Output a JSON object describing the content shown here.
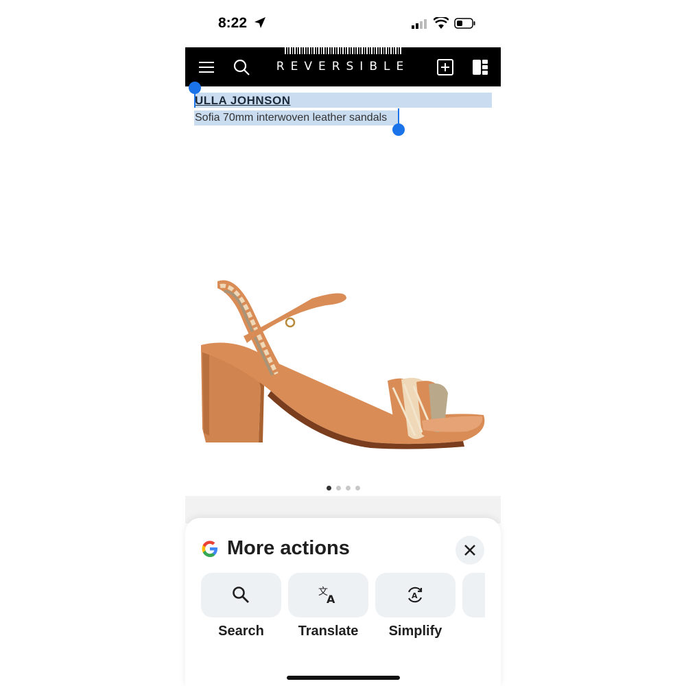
{
  "status_bar": {
    "time": "8:22"
  },
  "header": {
    "brand": "REVERSIBLE"
  },
  "product": {
    "designer": "ULLA JOHNSON",
    "name": "Sofia 70mm interwoven leather sandals"
  },
  "gallery": {
    "page_count": 4,
    "active_index": 0
  },
  "sheet": {
    "title": "More actions",
    "actions": [
      {
        "label": "Search",
        "icon": "search-icon"
      },
      {
        "label": "Translate",
        "icon": "translate-icon"
      },
      {
        "label": "Simplify",
        "icon": "simplify-icon"
      }
    ]
  },
  "colors": {
    "selection": "#c9dcf0",
    "selection_handle": "#1a73e8",
    "header_bg": "#000000",
    "sandal": "#d98c55"
  }
}
